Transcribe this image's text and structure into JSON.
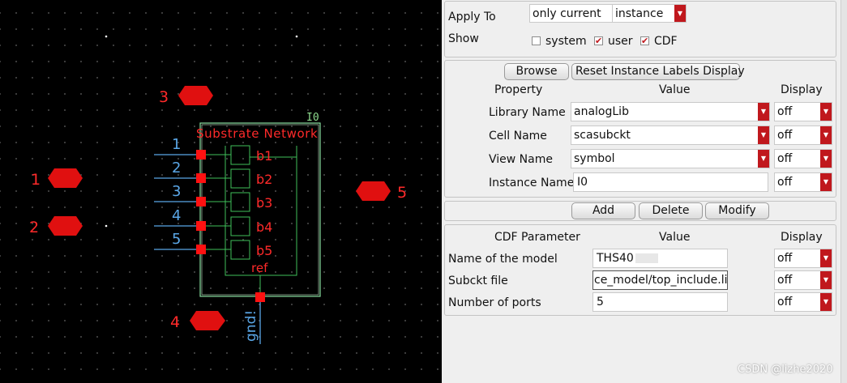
{
  "schematic": {
    "instance_name": "I0",
    "cell_title": "Substrate Network",
    "port_numbers": [
      "1",
      "2",
      "3",
      "4",
      "5"
    ],
    "pin_labels": [
      "b1",
      "b2",
      "b3",
      "b4",
      "b5"
    ],
    "ref_label": "ref",
    "ground_label": "gnd!",
    "external_nodes": [
      "1",
      "2",
      "3",
      "4",
      "5"
    ]
  },
  "header": {
    "apply_to_label": "Apply To",
    "apply_to_value": "only current",
    "apply_to_scope": "instance",
    "show_label": "Show",
    "show_options": [
      {
        "label": "system",
        "checked": false
      },
      {
        "label": "user",
        "checked": true
      },
      {
        "label": "CDF",
        "checked": true
      }
    ]
  },
  "instance_section": {
    "browse_label": "Browse",
    "reset_label": "Reset Instance Labels Display",
    "col_property": "Property",
    "col_value": "Value",
    "col_display": "Display",
    "rows": [
      {
        "label": "Library Name",
        "value": "analogLib",
        "display": "off"
      },
      {
        "label": "Cell Name",
        "value": "scasubckt",
        "display": "off"
      },
      {
        "label": "View Name",
        "value": "symbol",
        "display": "off"
      },
      {
        "label": "Instance Name",
        "value": "I0",
        "display": "off"
      }
    ]
  },
  "actions": {
    "add_label": "Add",
    "delete_label": "Delete",
    "modify_label": "Modify"
  },
  "cdf_section": {
    "col_param": "CDF Parameter",
    "col_value": "Value",
    "col_display": "Display",
    "rows": [
      {
        "label": "Name of the model",
        "value": "THS40",
        "display": "off"
      },
      {
        "label": "Subckt file",
        "value": "ce_model/top_include.lib",
        "display": "off"
      },
      {
        "label": "Number of ports",
        "value": "5",
        "display": "off"
      }
    ]
  },
  "watermark": "CSDN @lizhe2020",
  "colors": {
    "canvas_bg": "#000000",
    "wire": "#5aa6e6",
    "pin": "#ff0000",
    "symbol_outline": "#88e0a0",
    "accent_arrow": "#c0181d"
  }
}
